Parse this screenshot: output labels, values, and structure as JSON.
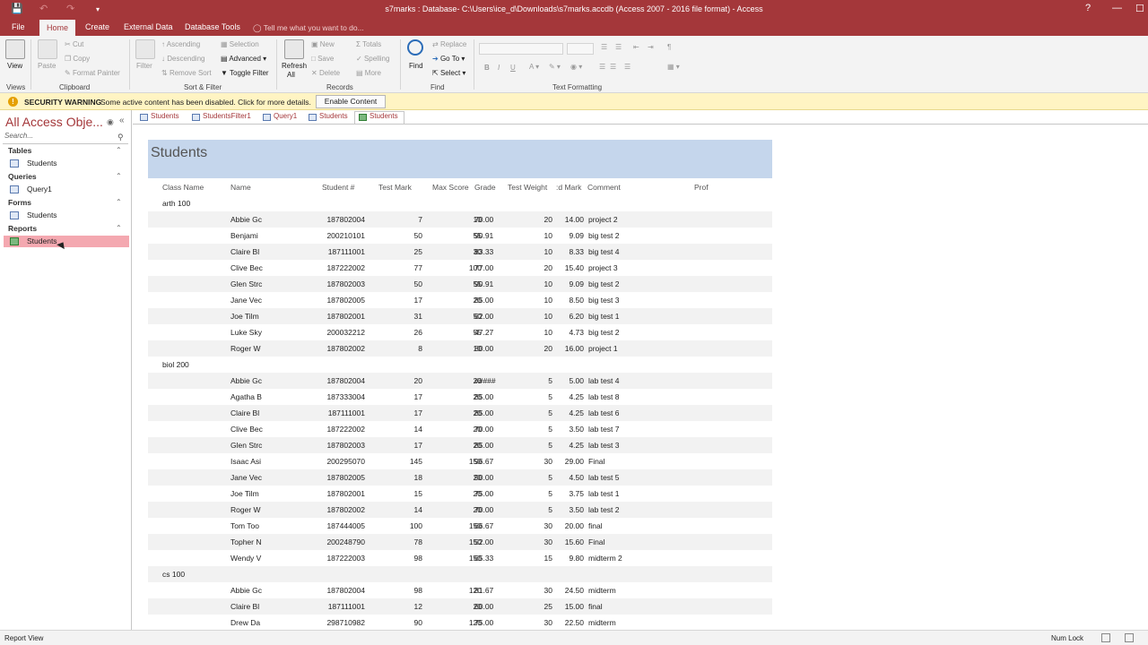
{
  "window": {
    "title": "s7marks : Database- C:\\Users\\ice_d\\Downloads\\s7marks.accdb (Access 2007 - 2016 file format) - Access",
    "help": "?",
    "minimize": "—",
    "maximize": "☐"
  },
  "ribbon_tabs": [
    "File",
    "Home",
    "Create",
    "External Data",
    "Database Tools"
  ],
  "tell_me": "Tell me what you want to do...",
  "ribbon": {
    "views": {
      "view": "View",
      "label": "Views"
    },
    "clipboard": {
      "paste": "Paste",
      "cut": "Cut",
      "copy": "Copy",
      "format_painter": "Format Painter",
      "label": "Clipboard"
    },
    "sort_filter": {
      "filter": "Filter",
      "ascending": "Ascending",
      "descending": "Descending",
      "remove_sort": "Remove Sort",
      "selection": "Selection",
      "advanced": "Advanced",
      "toggle_filter": "Toggle Filter",
      "label": "Sort & Filter"
    },
    "records": {
      "refresh": "Refresh",
      "refresh_all": "All",
      "new": "New",
      "save": "Save",
      "delete": "Delete",
      "totals": "Totals",
      "spelling": "Spelling",
      "more": "More",
      "label": "Records"
    },
    "find": {
      "find": "Find",
      "replace": "Replace",
      "goto": "Go To",
      "select": "Select",
      "label": "Find"
    },
    "text_formatting": {
      "bold": "B",
      "italic": "I",
      "underline": "U",
      "label": "Text Formatting"
    }
  },
  "security": {
    "title": "SECURITY WARNING",
    "message": "Some active content has been disabled. Click for more details.",
    "button": "Enable Content"
  },
  "nav": {
    "title": "All Access Obje...",
    "search_placeholder": "Search...",
    "categories": [
      {
        "name": "Tables",
        "items": [
          "Students"
        ]
      },
      {
        "name": "Queries",
        "items": [
          "Query1"
        ]
      },
      {
        "name": "Forms",
        "items": [
          "Students"
        ]
      },
      {
        "name": "Reports",
        "items": [
          "Students"
        ]
      }
    ]
  },
  "doc_tabs": [
    "Students",
    "StudentsFilter1",
    "Query1",
    "Students",
    "Students"
  ],
  "report": {
    "title": "Students",
    "columns": [
      "Class Name",
      "Name",
      "Student #",
      "Test Mark",
      "Max Score",
      "Grade",
      "Test Weight",
      ":d Mark",
      "Comment",
      "Prof"
    ],
    "groups": [
      {
        "name": "arth 100",
        "rows": [
          [
            "Abbie Gc",
            "187802004",
            "7",
            "10",
            "70.00",
            "20",
            "14.00",
            "project 2"
          ],
          [
            "Benjami",
            "200210101",
            "50",
            "55",
            "90.91",
            "10",
            "9.09",
            "big test 2"
          ],
          [
            "Claire Bl",
            "187111001",
            "25",
            "30",
            "83.33",
            "10",
            "8.33",
            "big test 4"
          ],
          [
            "Clive Bec",
            "187222002",
            "77",
            "100",
            "77.00",
            "20",
            "15.40",
            "project 3"
          ],
          [
            "Glen Strc",
            "187802003",
            "50",
            "55",
            "90.91",
            "10",
            "9.09",
            "big test 2"
          ],
          [
            "Jane Vec",
            "187802005",
            "17",
            "20",
            "85.00",
            "10",
            "8.50",
            "big test 3"
          ],
          [
            "Joe Tilm",
            "187802001",
            "31",
            "50",
            "62.00",
            "10",
            "6.20",
            "big test 1"
          ],
          [
            "Luke Sky",
            "200032212",
            "26",
            "55",
            "47.27",
            "10",
            "4.73",
            "big test 2"
          ],
          [
            "Roger W",
            "187802002",
            "8",
            "10",
            "80.00",
            "20",
            "16.00",
            "project 1"
          ]
        ]
      },
      {
        "name": "biol 200",
        "rows": [
          [
            "Abbie Gc",
            "187802004",
            "20",
            "20",
            "#####",
            "5",
            "5.00",
            "lab test 4"
          ],
          [
            "Agatha B",
            "187333004",
            "17",
            "20",
            "85.00",
            "5",
            "4.25",
            "lab test 8"
          ],
          [
            "Claire Bl",
            "187111001",
            "17",
            "20",
            "85.00",
            "5",
            "4.25",
            "lab test 6"
          ],
          [
            "Clive Bec",
            "187222002",
            "14",
            "20",
            "70.00",
            "5",
            "3.50",
            "lab test 7"
          ],
          [
            "Glen Strc",
            "187802003",
            "17",
            "20",
            "85.00",
            "5",
            "4.25",
            "lab test 3"
          ],
          [
            "Isaac Asi",
            "200295070",
            "145",
            "150",
            "96.67",
            "30",
            "29.00",
            "Final"
          ],
          [
            "Jane Vec",
            "187802005",
            "18",
            "20",
            "90.00",
            "5",
            "4.50",
            "lab test 5"
          ],
          [
            "Joe Tilm",
            "187802001",
            "15",
            "20",
            "75.00",
            "5",
            "3.75",
            "lab test 1"
          ],
          [
            "Roger W",
            "187802002",
            "14",
            "20",
            "70.00",
            "5",
            "3.50",
            "lab test 2"
          ],
          [
            "Tom Too",
            "187444005",
            "100",
            "150",
            "66.67",
            "30",
            "20.00",
            "final"
          ],
          [
            "Topher N",
            "200248790",
            "78",
            "150",
            "52.00",
            "30",
            "15.60",
            "Final"
          ],
          [
            "Wendy V",
            "187222003",
            "98",
            "150",
            "65.33",
            "15",
            "9.80",
            "midterm 2"
          ]
        ]
      },
      {
        "name": "cs 100",
        "rows": [
          [
            "Abbie Gc",
            "187802004",
            "98",
            "120",
            "81.67",
            "30",
            "24.50",
            "midterm"
          ],
          [
            "Claire Bl",
            "187111001",
            "12",
            "20",
            "60.00",
            "25",
            "15.00",
            "final"
          ],
          [
            "Drew Da",
            "298710982",
            "90",
            "120",
            "75.00",
            "30",
            "22.50",
            "midterm"
          ]
        ]
      }
    ]
  },
  "status": {
    "left": "Report View",
    "num_lock": "Num Lock"
  }
}
